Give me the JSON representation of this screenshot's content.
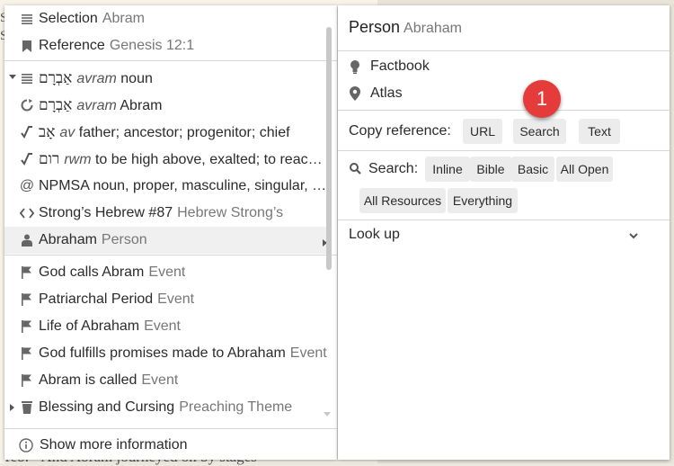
{
  "background": {
    "bottom_text": "reb. ⁹ And Abram journeyed on by stages"
  },
  "menu": {
    "items": [
      {
        "icon": "lines-icon",
        "primary": "Selection",
        "secondary": "Abram"
      },
      {
        "icon": "bookmark-icon",
        "primary": "Reference",
        "secondary": "Genesis 12:1"
      },
      {
        "icon": "lines-icon",
        "hebrew": "אַבְרָם",
        "italic": "avram",
        "primary": "noun",
        "expandable": true
      },
      {
        "icon": "refresh-icon",
        "hebrew": "אַבְרָם",
        "italic": "avram",
        "primary": "Abram"
      },
      {
        "icon": "root-icon",
        "hebrew": "אָב",
        "italic": "av",
        "primary": "father; ancestor; progenitor; chief"
      },
      {
        "icon": "root-icon",
        "hebrew": "רום",
        "italic": "rwm",
        "primary": "to be high above, exalted; to reac…"
      },
      {
        "icon": "at-icon",
        "primary": "NPMSA noun, proper, masculine, singular, a…"
      },
      {
        "icon": "code-icon",
        "primary": "Strong’s Hebrew #87",
        "secondary": "Hebrew Strong’s"
      },
      {
        "icon": "person-icon",
        "primary": "Abraham",
        "secondary": "Person",
        "active": true,
        "submenu": true
      },
      {
        "icon": "flag-icon",
        "primary": "God calls Abram",
        "secondary": "Event"
      },
      {
        "icon": "flag-icon",
        "primary": "Patriarchal Period",
        "secondary": "Event"
      },
      {
        "icon": "flag-icon",
        "primary": "Life of Abraham",
        "secondary": "Event"
      },
      {
        "icon": "flag-icon",
        "primary": "God fulfills promises made to Abraham",
        "secondary": "Event"
      },
      {
        "icon": "flag-icon",
        "primary": "Abram is called",
        "secondary": "Event"
      },
      {
        "icon": "trash-icon",
        "primary": "Blessing and Cursing",
        "secondary": "Preaching Theme",
        "expandable": true
      }
    ],
    "show_more": "Show more information"
  },
  "panel": {
    "title": "Person",
    "subtitle": "Abraham",
    "links": [
      {
        "icon": "lightbulb-icon",
        "label": "Factbook"
      },
      {
        "icon": "location-pin-icon",
        "label": "Atlas"
      }
    ],
    "copy_reference_label": "Copy reference:",
    "copy_buttons": [
      "URL",
      "Search",
      "Text"
    ],
    "search_label": "Search:",
    "search_buttons": [
      "Inline",
      "Bible",
      "Basic",
      "All Open",
      "All Resources",
      "Everything"
    ],
    "lookup_label": "Look up"
  },
  "callout_badge": "1"
}
